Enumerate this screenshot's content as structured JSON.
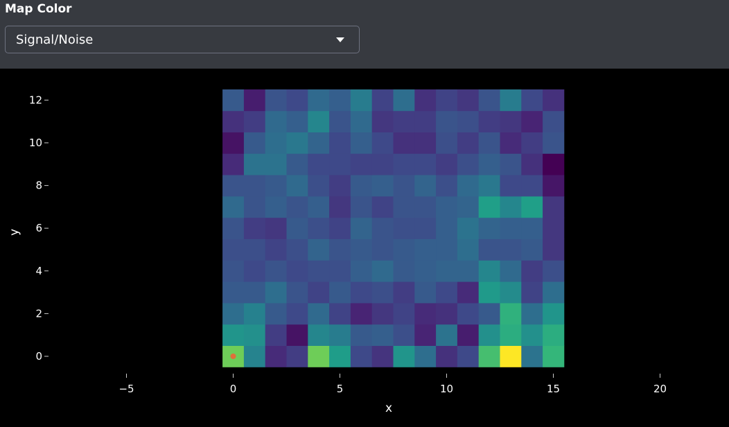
{
  "control": {
    "label": "Map Color",
    "selected": "Signal/Noise"
  },
  "icons": {
    "dropdown": "chevron-down-icon"
  },
  "chart_data": {
    "type": "heatmap",
    "colorscale": "viridis",
    "xlabel": "x",
    "ylabel": "y",
    "xlim": [
      -8.1,
      22.2
    ],
    "ylim": [
      -0.5,
      12.5
    ],
    "xticks": [
      -5,
      0,
      5,
      10,
      15,
      20
    ],
    "yticks": [
      0,
      2,
      4,
      6,
      8,
      10,
      12
    ],
    "x": [
      0,
      1,
      2,
      3,
      4,
      5,
      6,
      7,
      8,
      9,
      10,
      11,
      12,
      13,
      14,
      15
    ],
    "y": [
      0,
      1,
      2,
      3,
      4,
      5,
      6,
      7,
      8,
      9,
      10,
      11,
      12
    ],
    "z": [
      [
        0.78,
        0.45,
        0.12,
        0.18,
        0.78,
        0.55,
        0.22,
        0.15,
        0.52,
        0.36,
        0.14,
        0.22,
        0.7,
        1.0,
        0.38,
        0.66
      ],
      [
        0.52,
        0.5,
        0.18,
        0.05,
        0.46,
        0.42,
        0.28,
        0.3,
        0.24,
        0.1,
        0.38,
        0.08,
        0.5,
        0.62,
        0.5,
        0.62
      ],
      [
        0.36,
        0.44,
        0.28,
        0.22,
        0.34,
        0.2,
        0.1,
        0.16,
        0.2,
        0.12,
        0.14,
        0.22,
        0.28,
        0.64,
        0.36,
        0.52
      ],
      [
        0.28,
        0.28,
        0.36,
        0.26,
        0.2,
        0.28,
        0.22,
        0.24,
        0.18,
        0.28,
        0.22,
        0.12,
        0.54,
        0.48,
        0.2,
        0.36
      ],
      [
        0.26,
        0.22,
        0.26,
        0.22,
        0.24,
        0.24,
        0.3,
        0.34,
        0.28,
        0.3,
        0.32,
        0.32,
        0.46,
        0.34,
        0.18,
        0.24
      ],
      [
        0.24,
        0.24,
        0.2,
        0.24,
        0.32,
        0.26,
        0.28,
        0.26,
        0.28,
        0.3,
        0.3,
        0.36,
        0.26,
        0.26,
        0.28,
        0.16
      ],
      [
        0.26,
        0.18,
        0.16,
        0.28,
        0.24,
        0.2,
        0.32,
        0.26,
        0.24,
        0.24,
        0.3,
        0.38,
        0.32,
        0.3,
        0.3,
        0.16
      ],
      [
        0.34,
        0.26,
        0.3,
        0.26,
        0.3,
        0.16,
        0.26,
        0.2,
        0.26,
        0.26,
        0.3,
        0.32,
        0.56,
        0.46,
        0.56,
        0.16
      ],
      [
        0.26,
        0.26,
        0.28,
        0.34,
        0.24,
        0.18,
        0.28,
        0.3,
        0.26,
        0.32,
        0.24,
        0.34,
        0.4,
        0.22,
        0.22,
        0.06
      ],
      [
        0.12,
        0.38,
        0.38,
        0.28,
        0.22,
        0.22,
        0.2,
        0.2,
        0.22,
        0.22,
        0.18,
        0.24,
        0.3,
        0.26,
        0.14,
        0.0
      ],
      [
        0.05,
        0.28,
        0.36,
        0.4,
        0.32,
        0.22,
        0.3,
        0.22,
        0.14,
        0.14,
        0.24,
        0.18,
        0.26,
        0.12,
        0.18,
        0.26
      ],
      [
        0.14,
        0.18,
        0.34,
        0.3,
        0.46,
        0.26,
        0.34,
        0.16,
        0.18,
        0.18,
        0.26,
        0.24,
        0.18,
        0.16,
        0.1,
        0.24
      ],
      [
        0.28,
        0.08,
        0.26,
        0.22,
        0.34,
        0.3,
        0.42,
        0.2,
        0.36,
        0.14,
        0.2,
        0.16,
        0.26,
        0.42,
        0.22,
        0.14
      ]
    ],
    "marker": {
      "x": 0,
      "y": 0,
      "color": "#e0703a"
    },
    "grid": false,
    "background": "#000000",
    "font_color": "#ffffff"
  }
}
